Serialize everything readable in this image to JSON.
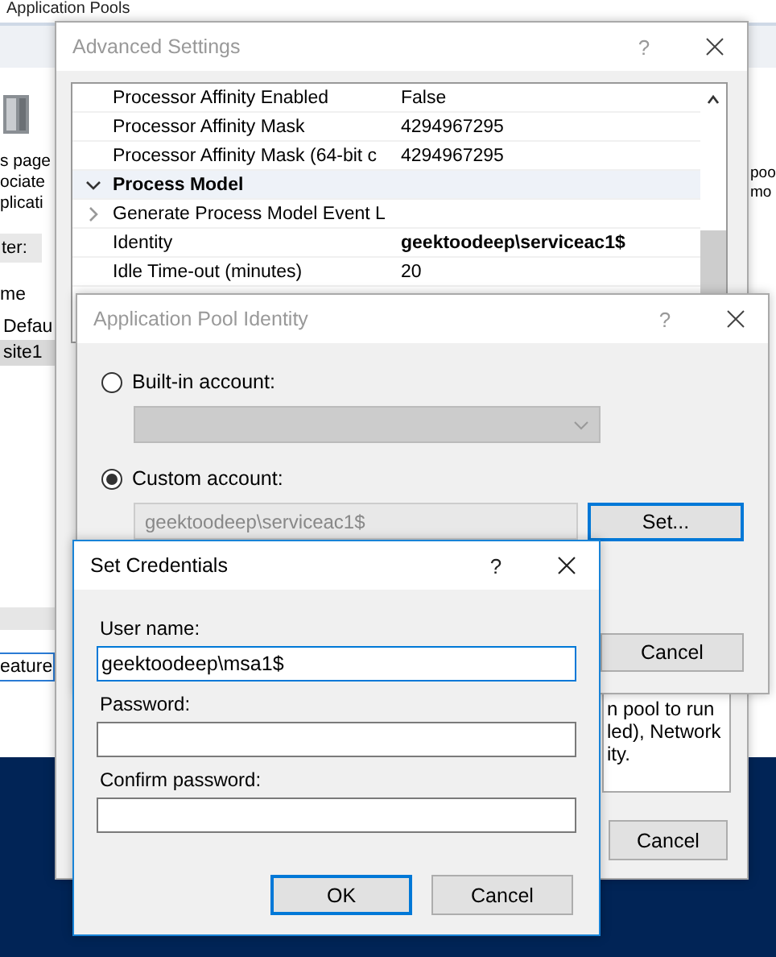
{
  "background_window": {
    "title": "Application Pools",
    "description_fragments": [
      "s page",
      "ociate",
      "plicati"
    ],
    "filter_label": "ter:",
    "list_header": "me",
    "list_items": [
      {
        "label": "Defau",
        "selected": false
      },
      {
        "label": "site1",
        "selected": true
      }
    ],
    "tab_fragment": "eature",
    "right_fragments": [
      "poo",
      "mo"
    ]
  },
  "advanced_settings": {
    "title": "Advanced Settings",
    "active": false,
    "help_label": "?",
    "properties": [
      {
        "kind": "row",
        "name": "Processor Affinity Enabled",
        "value": "False",
        "value_bold": false
      },
      {
        "kind": "row",
        "name": "Processor Affinity Mask",
        "value": "4294967295",
        "value_bold": false
      },
      {
        "kind": "row",
        "name": "Processor Affinity Mask (64-bit c",
        "value": "4294967295",
        "value_bold": false
      },
      {
        "kind": "category",
        "name": "Process Model",
        "expanded": true
      },
      {
        "kind": "group",
        "name": "Generate Process Model Event L",
        "expanded": false
      },
      {
        "kind": "row",
        "name": "Identity",
        "value": "geektoodeep\\serviceac1$",
        "value_bold": true
      },
      {
        "kind": "row",
        "name": "Idle Time-out (minutes)",
        "value": "20",
        "value_bold": false
      }
    ],
    "description_lines": [
      "n pool to run",
      "led), Network",
      "ity."
    ],
    "cancel_label": "Cancel"
  },
  "app_pool_identity": {
    "title": "Application Pool Identity",
    "active": false,
    "help_label": "?",
    "options": [
      {
        "label": "Built-in account:",
        "selected": false
      },
      {
        "label": "Custom account:",
        "selected": true
      }
    ],
    "builtin_dropdown": {
      "disabled": true
    },
    "custom_field": {
      "value": "geektoodeep\\serviceac1$",
      "disabled": true
    },
    "set_button": {
      "label": "Set...",
      "focused": true
    },
    "cancel_button": {
      "label": "Cancel",
      "focused": false
    }
  },
  "set_credentials": {
    "title": "Set Credentials",
    "active": true,
    "help_label": "?",
    "fields": [
      {
        "label": "User name:",
        "value": "geektoodeep\\msa1$",
        "focused": true
      },
      {
        "label": "Password:",
        "focused": false
      },
      {
        "label": "Confirm password:",
        "focused": false
      }
    ],
    "buttons": [
      {
        "label": "OK",
        "focused": true
      },
      {
        "label": "Cancel",
        "focused": false
      }
    ]
  }
}
